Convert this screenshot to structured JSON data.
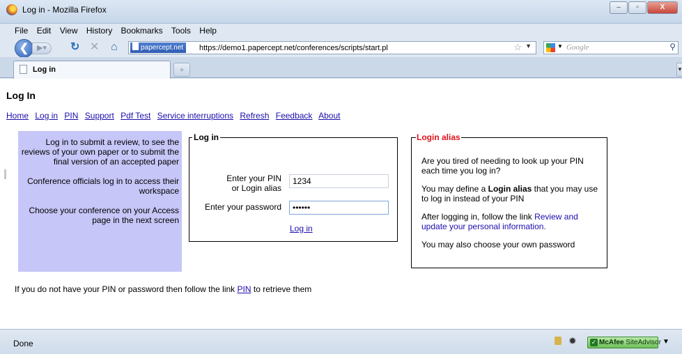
{
  "window": {
    "title": "Log in - Mozilla Firefox",
    "buttons": {
      "minimize": "–",
      "maximize": "▫",
      "close": "X"
    }
  },
  "menu": [
    "File",
    "Edit",
    "View",
    "History",
    "Bookmarks",
    "Tools",
    "Help"
  ],
  "toolbar": {
    "site_badge": "papercept.net",
    "url": "https://demo1.papercept.net/conferences/scripts/start.pl",
    "search_placeholder": "Google"
  },
  "tabs": [
    {
      "label": "Log in"
    }
  ],
  "page": {
    "title": "Log In",
    "nav_links": [
      "Home",
      "Log in",
      "PIN",
      "Support",
      "Pdf Test",
      "Service interruptions",
      "Refresh",
      "Feedback",
      "About"
    ],
    "info": [
      "Log in to submit a review, to see the reviews of your own paper or to submit the final version of an accepted paper",
      "Conference officials log in to access their workspace",
      "Choose your conference on your Access page in the next screen"
    ],
    "login": {
      "legend": "Log in",
      "pin_label_1": "Enter your PIN",
      "pin_label_2": "or Login alias",
      "pin_value": "1234",
      "password_label": "Enter your password",
      "password_value": "123456",
      "submit_link": "Log in"
    },
    "alias": {
      "legend": "Login alias",
      "p1": "Are you tired of needing to look up your PIN each time you log in?",
      "p2_pre": "You may define a ",
      "p2_bold": "Login alias",
      "p2_post": " that you may use to log in instead of your PIN",
      "p3_pre": "After logging in, follow the link ",
      "p3_link": "Review and update your personal information.",
      "p4": "You may also choose your own password"
    },
    "footer": {
      "pre": "If you do not have your PIN or password then follow the link ",
      "link": "PIN",
      "post": " to retrieve them"
    }
  },
  "status": {
    "text": "Done",
    "siteadvisor_brand": "McAfee",
    "siteadvisor_name": " SiteAdvisor"
  },
  "colors": {
    "info_panel_bg": "#c6c6f8",
    "alias_legend": "#e0111b",
    "link": "#1a0dab",
    "siteadvisor": "#6fbf5a"
  }
}
